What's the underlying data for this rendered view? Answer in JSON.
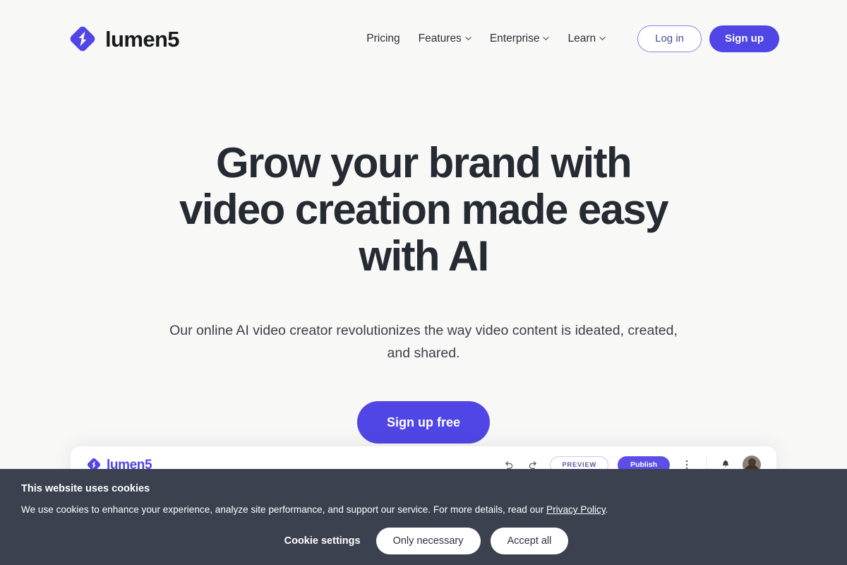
{
  "brand": {
    "name": "lumen5",
    "logo_icon": "lumen5-diamond-bolt-icon",
    "accent_color": "#4F46E5"
  },
  "header": {
    "nav": [
      {
        "label": "Pricing",
        "has_dropdown": false
      },
      {
        "label": "Features",
        "has_dropdown": true
      },
      {
        "label": "Enterprise",
        "has_dropdown": true
      },
      {
        "label": "Learn",
        "has_dropdown": true
      }
    ],
    "login_label": "Log in",
    "signup_label": "Sign up"
  },
  "hero": {
    "title": "Grow your brand with video creation made easy with AI",
    "subtitle": "Our online AI video creator revolutionizes the way video content is ideated, created, and shared.",
    "cta_label": "Sign up free"
  },
  "app_preview": {
    "brand_name": "lumen5",
    "undo_icon": "undo-arrow-icon",
    "redo_icon": "redo-arrow-icon",
    "preview_label": "PREVIEW",
    "publish_label": "Publish",
    "more_icon": "kebab-menu-icon",
    "notifications_icon": "bell-icon",
    "avatar_icon": "user-avatar"
  },
  "cookie_banner": {
    "title": "This website uses cookies",
    "text_before_link": "We use cookies to enhance your experience, analyze site performance, and support our service. For more details, read our ",
    "link_label": "Privacy Policy",
    "text_after_link": ".",
    "settings_label": "Cookie settings",
    "only_necessary_label": "Only necessary",
    "accept_all_label": "Accept all",
    "background_color": "#3C4150"
  }
}
